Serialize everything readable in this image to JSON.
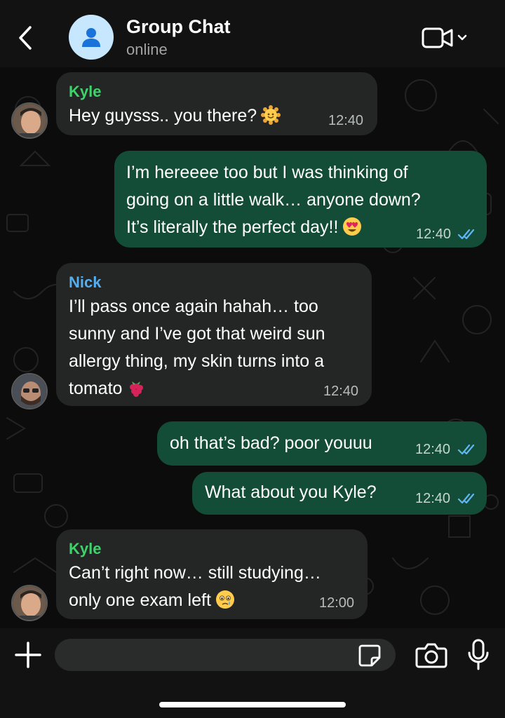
{
  "header": {
    "title": "Group Chat",
    "status": "online",
    "back_icon": "chevron-left-icon",
    "call_icon": "video-camera-icon"
  },
  "colors": {
    "incoming_bubble": "#242626",
    "outgoing_bubble": "#134d37",
    "kyle_name": "#3ed36a",
    "nick_name": "#54aef0",
    "read_ticks": "#5fb6f5",
    "group_avatar_bg": "#c7e7ff",
    "group_avatar_icon": "#1a73d9"
  },
  "messages": [
    {
      "direction": "incoming",
      "sender": "Kyle",
      "text_lines": [
        "Hey guysss.. you there?"
      ],
      "emoji": "smiling-sun-emoji",
      "time": "12:40"
    },
    {
      "direction": "outgoing",
      "text_lines": [
        "I’m hereeee too but I was thinking of",
        "going on a little walk… anyone down?",
        "It’s literally the perfect day!!"
      ],
      "emoji": "heart-eyes-emoji",
      "time": "12:40",
      "read": true
    },
    {
      "direction": "incoming",
      "sender": "Nick",
      "text_lines": [
        "I’ll pass once again hahah… too",
        "sunny and I’ve got that weird sun",
        "allergy thing, my skin turns into a",
        "tomato"
      ],
      "emoji": "raspberry-emoji",
      "time": "12:40"
    },
    {
      "direction": "outgoing",
      "text_lines": [
        "oh that’s bad? poor youuu"
      ],
      "time": "12:40",
      "read": true
    },
    {
      "direction": "outgoing",
      "text_lines": [
        "What about you Kyle?"
      ],
      "time": "12:40",
      "read": true
    },
    {
      "direction": "incoming",
      "sender": "Kyle",
      "text_lines": [
        "Can’t right now… still studying…",
        "only one exam left"
      ],
      "emoji": "holding-back-tears-emoji",
      "time": "12:00"
    }
  ],
  "composer": {
    "placeholder": "",
    "add_icon": "plus-icon",
    "sticker_icon": "sticker-icon",
    "camera_icon": "camera-icon",
    "mic_icon": "microphone-icon"
  }
}
